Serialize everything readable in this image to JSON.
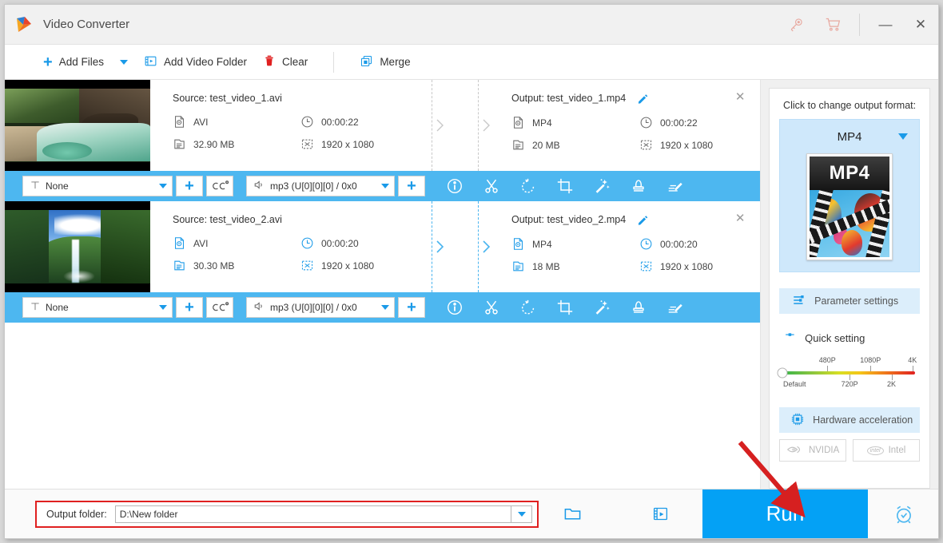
{
  "window": {
    "title": "Video Converter",
    "logo_icon": "app-logo-play-triangle",
    "license_icon": "key-icon",
    "cart_icon": "shopping-cart-icon",
    "minimize_label": "—",
    "close_label": "✕"
  },
  "toolbar": {
    "add_files": "Add Files",
    "add_files_caret": "chevron-down-icon",
    "add_video_folder": "Add Video Folder",
    "clear": "Clear",
    "merge": "Merge"
  },
  "accent": {
    "blue": "#1a9ae8",
    "action_bar": "#4db7f0",
    "run": "#04a1f5",
    "annotation_red": "#e02020",
    "panel_light_blue": "#cfe8fb"
  },
  "rows": [
    {
      "selected": false,
      "thumbnail": "rocky-gorge-stream",
      "source_label": "Source: test_video_1.avi",
      "source": {
        "format": "AVI",
        "duration": "00:00:22",
        "size": "32.90 MB",
        "resolution": "1920 x 1080"
      },
      "output_label": "Output: test_video_1.mp4",
      "output": {
        "format": "MP4",
        "duration": "00:00:22",
        "size": "20 MB",
        "resolution": "1920 x 1080"
      },
      "subtitle_value": "None",
      "audio_value": "mp3 (U[0][0][0] / 0x0"
    },
    {
      "selected": true,
      "thumbnail": "tall-waterfall",
      "source_label": "Source: test_video_2.avi",
      "source": {
        "format": "AVI",
        "duration": "00:00:20",
        "size": "30.30 MB",
        "resolution": "1920 x 1080"
      },
      "output_label": "Output: test_video_2.mp4",
      "output": {
        "format": "MP4",
        "duration": "00:00:20",
        "size": "18 MB",
        "resolution": "1920 x 1080"
      },
      "subtitle_value": "None",
      "audio_value": "mp3 (U[0][0][0] / 0x0"
    }
  ],
  "action_bar": {
    "subtitle_icon": "subtitle-t-icon",
    "add_subtitle_icon": "plus-icon",
    "cc_icon": "closed-caption-icon",
    "audio_icon": "speaker-icon",
    "add_audio_icon": "plus-icon",
    "tools": [
      {
        "name": "info-icon",
        "label": "Info"
      },
      {
        "name": "scissors-cut-icon",
        "label": "Cut"
      },
      {
        "name": "rotate-icon",
        "label": "Rotate"
      },
      {
        "name": "crop-icon",
        "label": "Crop"
      },
      {
        "name": "magic-wand-effect-icon",
        "label": "Effect"
      },
      {
        "name": "watermark-stamp-icon",
        "label": "Watermark"
      },
      {
        "name": "subtitle-edit-icon",
        "label": "Subtitle edit"
      }
    ]
  },
  "sidebar": {
    "change_format_label": "Click to change output format:",
    "format_name": "MP4",
    "format_thumb_text": "MP4",
    "parameter_settings": "Parameter settings",
    "quick_setting": "Quick setting",
    "slider": {
      "top_ticks": [
        "480P",
        "1080P",
        "4K"
      ],
      "bottom_ticks": [
        "Default",
        "720P",
        "2K"
      ],
      "value": "Default"
    },
    "hardware_acceleration": "Hardware acceleration",
    "gpu_options": [
      "NVIDIA",
      "Intel"
    ]
  },
  "bottom": {
    "output_folder_label": "Output folder:",
    "output_folder_value": "D:\\New folder",
    "folder_icon": "open-folder-icon",
    "media_icon": "media-file-icon",
    "run_label": "Run",
    "alarm_icon": "alarm-clock-icon"
  }
}
